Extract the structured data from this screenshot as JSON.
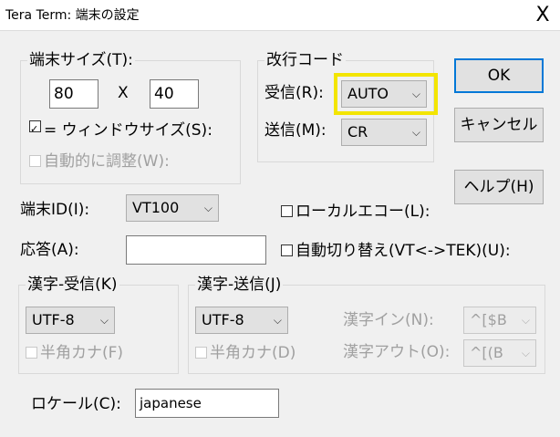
{
  "window": {
    "title": "Tera Term: 端末の設定",
    "close_glyph": "X"
  },
  "terminal_size": {
    "legend": "端末サイズ(T):",
    "cols": "80",
    "times": "X",
    "rows": "40",
    "term_size_equals_window_label": "= ウィンドウサイズ(S):",
    "term_size_equals_window_checked": true,
    "auto_resize_label": "自動的に調整(W):",
    "auto_resize_checked": false
  },
  "newline": {
    "legend": "改行コード",
    "receive_label": "受信(R):",
    "receive_value": "AUTO",
    "transmit_label": "送信(M):",
    "transmit_value": "CR"
  },
  "buttons": {
    "ok": "OK",
    "cancel": "キャンセル",
    "help": "ヘルプ(H)"
  },
  "terminal_id": {
    "label": "端末ID(I):",
    "value": "VT100"
  },
  "local_echo": {
    "label": "ローカルエコー(L):",
    "checked": false
  },
  "answerback": {
    "label": "応答(A):",
    "value": ""
  },
  "auto_switch": {
    "label": "自動切り替え(VT<->TEK)(U):",
    "checked": false
  },
  "kanji_receive": {
    "legend": "漢字-受信(K)",
    "value": "UTF-8",
    "halfwidth_label": "半角カナ(F)",
    "halfwidth_checked": false
  },
  "kanji_transmit": {
    "legend": "漢字-送信(J)",
    "value": "UTF-8",
    "halfwidth_label": "半角カナ(D)",
    "halfwidth_checked": false,
    "kanji_in_label": "漢字イン(N):",
    "kanji_in_value": "^[$B",
    "kanji_out_label": "漢字アウト(O):",
    "kanji_out_value": "^[(B"
  },
  "locale": {
    "label": "ロケール(C):",
    "value": "japanese"
  },
  "icons": {
    "dropdown": "chevron-down-icon",
    "close": "close-icon",
    "checkbox": "checkbox-icon"
  }
}
